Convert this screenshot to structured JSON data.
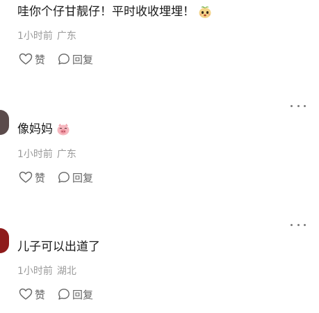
{
  "comments": [
    {
      "text": "哇你个仔甘靓仔！平时收收埋埋！",
      "emoji": "peach-face-emoji",
      "time": "1小时前",
      "location": "广东",
      "like_label": "赞",
      "reply_label": "回复"
    },
    {
      "text": "像妈妈",
      "emoji": "pig-face-emoji",
      "time": "1小时前",
      "location": "广东",
      "like_label": "赞",
      "reply_label": "回复"
    },
    {
      "text": "儿子可以出道了",
      "time": "1小时前",
      "location": "湖北",
      "like_label": "赞",
      "reply_label": "回复"
    }
  ],
  "colors": {
    "text": "#1a1a1a",
    "meta": "#9a9a9a",
    "action": "#666666",
    "avatar_2": "#5b4b4b",
    "avatar_3": "#8e1b1b"
  }
}
